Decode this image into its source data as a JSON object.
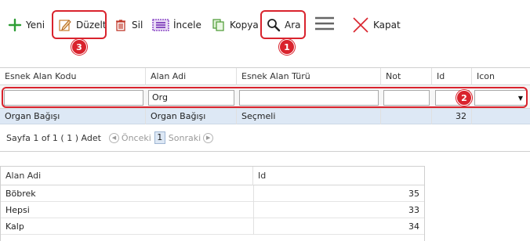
{
  "toolbar": {
    "new_label": "Yeni",
    "edit_label": "Düzelt",
    "delete_label": "Sil",
    "inspect_label": "İncele",
    "copy_label": "Kopya",
    "search_label": "Ara",
    "close_label": "Kapat"
  },
  "badges": {
    "search": "1",
    "filter": "2",
    "edit": "3"
  },
  "grid1": {
    "columns": [
      "Esnek Alan Kodu",
      "Alan Adi",
      "Esnek Alan Türü",
      "Not",
      "Id",
      "Icon"
    ],
    "filters": {
      "alan_adi": "Org"
    },
    "rows": [
      {
        "kod": "Organ Bağışı",
        "alan_adi": "Organ Bağışı",
        "tur": "Seçmeli",
        "not": "",
        "id": "32",
        "icon": ""
      }
    ],
    "pager": {
      "summary": "Sayfa 1 of 1 ( 1 ) Adet",
      "prev_label": "Önceki",
      "current_page": "1",
      "next_label": "Sonraki"
    }
  },
  "grid2": {
    "columns": [
      "Alan Adi",
      "Id"
    ],
    "rows": [
      {
        "alan_adi": "Böbrek",
        "id": "35"
      },
      {
        "alan_adi": "Hepsi",
        "id": "33"
      },
      {
        "alan_adi": "Kalp",
        "id": "34"
      }
    ]
  },
  "colors": {
    "highlight": "#d9232d",
    "selected_row": "#dde8f5",
    "new_icon": "#2e9e35"
  }
}
